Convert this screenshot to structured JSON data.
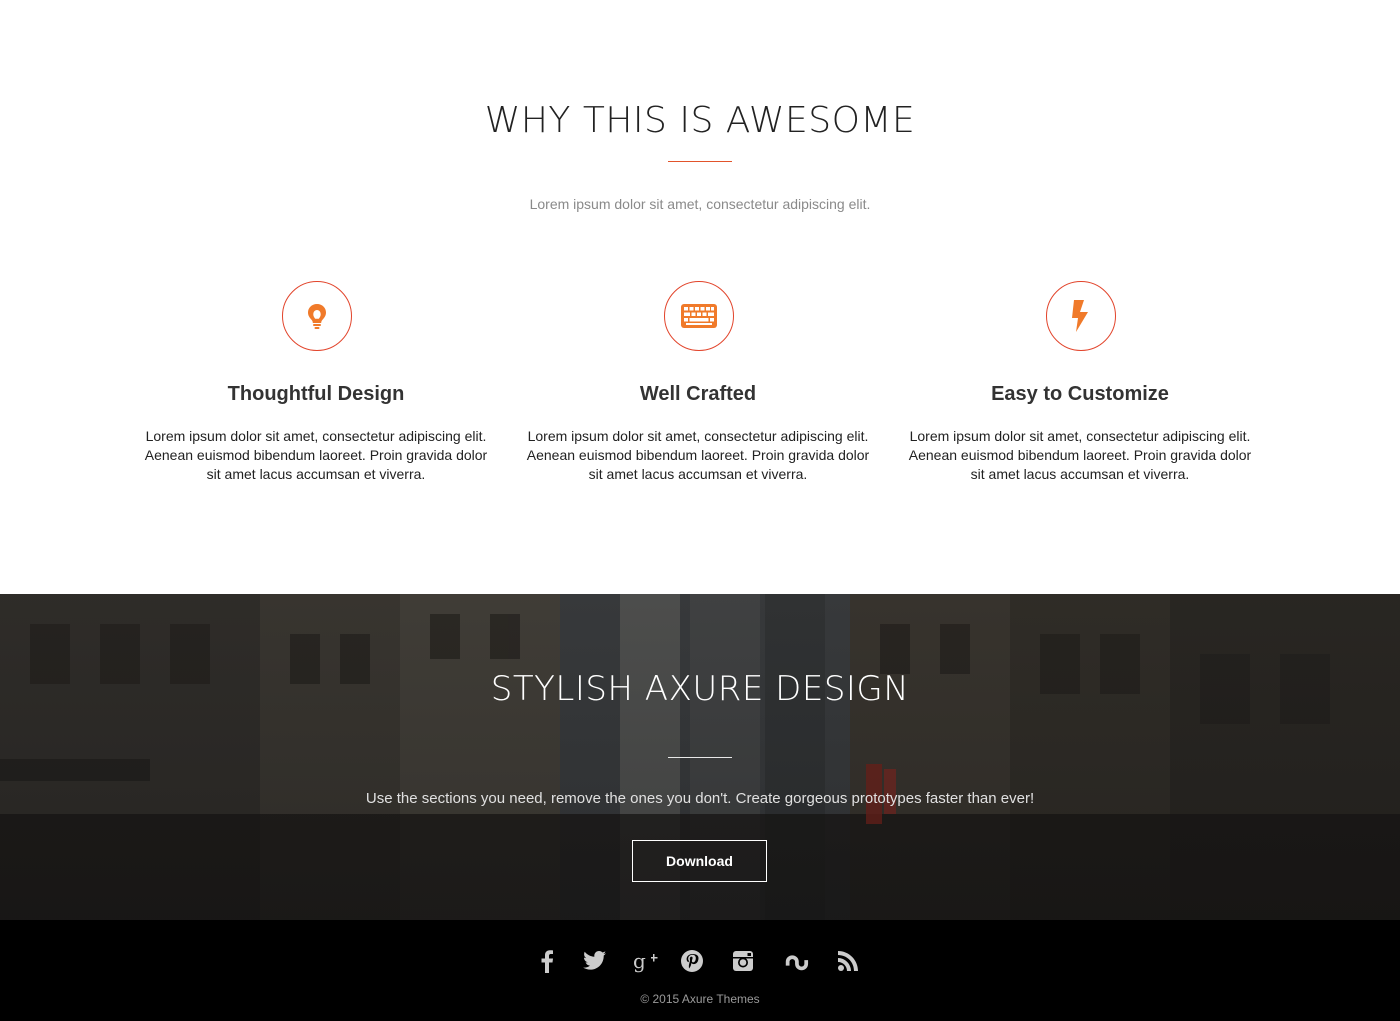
{
  "features": {
    "title": "WHY THIS IS AWESOME",
    "subtitle": "Lorem ipsum dolor sit amet, consectetur adipiscing elit.",
    "items": [
      {
        "icon": "lightbulb-icon",
        "title": "Thoughtful Design",
        "text": "Lorem ipsum dolor sit amet, consectetur adipiscing elit. Aenean euismod bibendum laoreet. Proin gravida  dolor sit amet lacus accumsan et viverra."
      },
      {
        "icon": "keyboard-icon",
        "title": "Well Crafted",
        "text": "Lorem ipsum dolor sit amet, consectetur adipiscing elit. Aenean euismod bibendum laoreet. Proin gravida  dolor sit amet lacus accumsan et viverra."
      },
      {
        "icon": "lightning-bolt-icon",
        "title": "Easy to Customize",
        "text": "Lorem ipsum dolor sit amet, consectetur adipiscing elit. Aenean euismod bibendum laoreet. Proin gravida  dolor sit amet lacus accumsan et viverra."
      }
    ]
  },
  "cta": {
    "title": "STYLISH AXURE DESIGN",
    "text": "Use the sections you need, remove the ones you don't.  Create gorgeous prototypes faster than ever!",
    "button_label": "Download"
  },
  "footer": {
    "social": [
      "facebook-icon",
      "twitter-icon",
      "google-plus-icon",
      "pinterest-icon",
      "instagram-icon",
      "stumbleupon-icon",
      "rss-icon"
    ],
    "copyright": "© 2015 Axure Themes"
  },
  "colors": {
    "accent": "#e2442b",
    "icon_orange": "#f07a2a",
    "footer_bg": "#000000"
  }
}
